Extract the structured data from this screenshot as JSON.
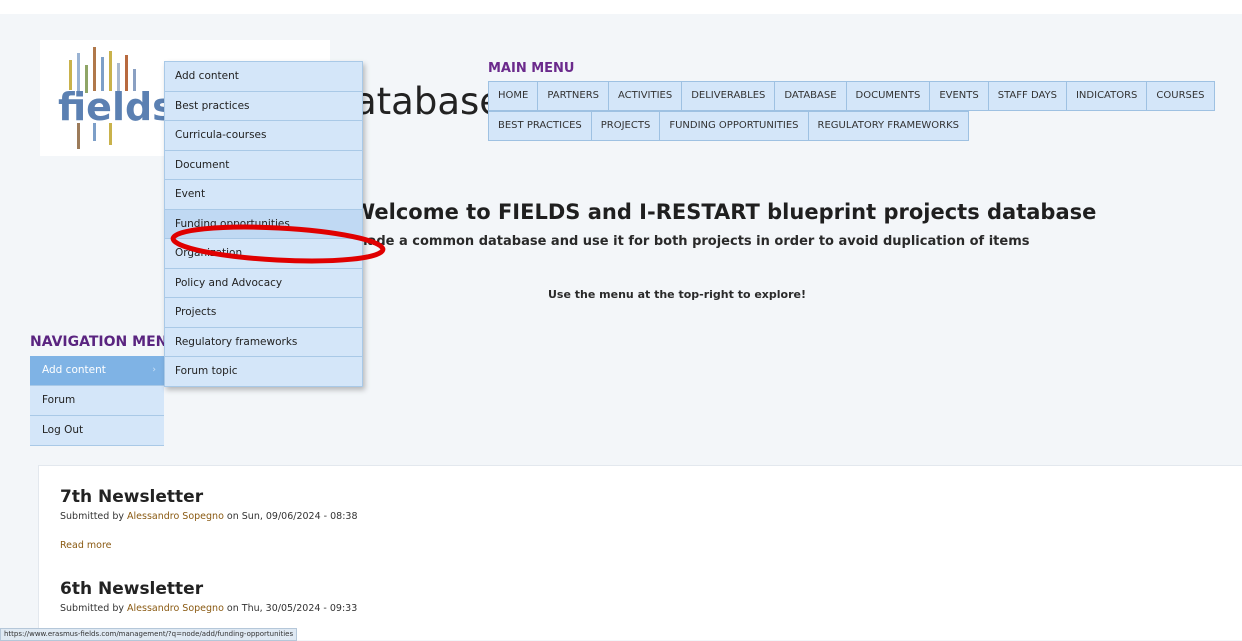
{
  "site": {
    "logo_text": "fields",
    "name_fragment": "atabase"
  },
  "main_menu": {
    "title": "MAIN MENU",
    "row1": [
      "HOME",
      "PARTNERS",
      "ACTIVITIES",
      "DELIVERABLES",
      "DATABASE",
      "DOCUMENTS",
      "EVENTS",
      "STAFF DAYS",
      "INDICATORS",
      "COURSES"
    ],
    "row2": [
      "BEST PRACTICES",
      "PROJECTS",
      "FUNDING OPPORTUNITIES",
      "REGULATORY FRAMEWORKS"
    ]
  },
  "welcome": {
    "title": "Welcome to FIELDS and I-RESTART blueprint projects database",
    "subtitle": "made a common database and use it for both projects in order to avoid duplication of items",
    "hint": "Use the menu at the top-right to explore!"
  },
  "navigation": {
    "title": "NAVIGATION MENU",
    "items": [
      "Add content",
      "Forum",
      "Log Out"
    ],
    "submenu_arrow": "›"
  },
  "dropdown": {
    "items": [
      "Add content",
      "Best practices",
      "Curricula-courses",
      "Document",
      "Event",
      "Funding opportunities",
      "Organization",
      "Policy and Advocacy",
      "Projects",
      "Regulatory frameworks",
      "Forum topic"
    ]
  },
  "nodes": [
    {
      "title": "7th Newsletter",
      "submitted_by": "Submitted by",
      "author": "Alessandro Sopegno",
      "date": "on Sun, 09/06/2024 - 08:38",
      "read_more": "Read more"
    },
    {
      "title": "6th Newsletter",
      "submitted_by": "Submitted by",
      "author": "Alessandro Sopegno",
      "date": "on Thu, 30/05/2024 - 09:33"
    }
  ],
  "status_url": "https://www.erasmus-fields.com/management/?q=node/add/funding-opportunities",
  "colors": {
    "menu_bg": "#d4e6f9",
    "menu_title": "#6b2a8c",
    "annotation": "#e00000",
    "author_link": "#8a5a12"
  }
}
